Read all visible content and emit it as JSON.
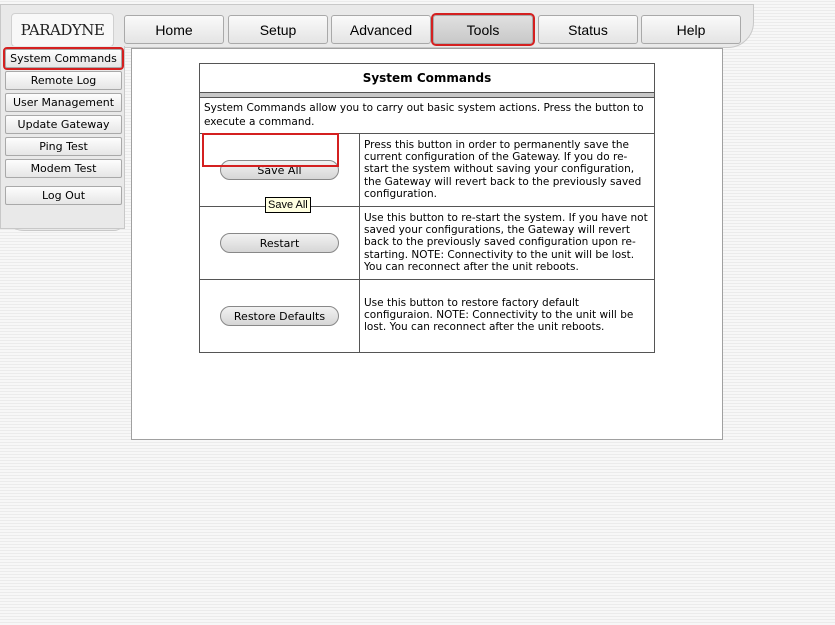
{
  "logo": "PARADYNE",
  "tabs": [
    "Home",
    "Setup",
    "Advanced",
    "Tools",
    "Status",
    "Help"
  ],
  "active_tab": "Tools",
  "sidebar": {
    "items": [
      "System Commands",
      "Remote Log",
      "User Management",
      "Update Gateway",
      "Ping Test",
      "Modem Test"
    ],
    "logout": "Log Out",
    "active_item": "System Commands"
  },
  "main": {
    "title": "System Commands",
    "intro": "System Commands allow you to carry out basic system actions. Press the button to execute a command.",
    "commands": [
      {
        "label": "Save All",
        "description": "Press this button in order to permanently save the current configuration of the Gateway. If you do re-start the system without saving your configuration, the Gateway will revert back to the previously saved configuration."
      },
      {
        "label": "Restart",
        "description": "Use this button to re-start the system. If you have not saved your configurations, the Gateway will revert back to the previously saved configuration upon re-starting. NOTE: Connectivity to the unit will be lost. You can reconnect after the unit reboots."
      },
      {
        "label": "Restore Defaults",
        "description": "Use this button to restore factory default configuraion. NOTE: Connectivity to the unit will be lost. You can reconnect after the unit reboots."
      }
    ]
  },
  "tooltip": "Save All",
  "colors": {
    "highlight": "#d42020"
  }
}
